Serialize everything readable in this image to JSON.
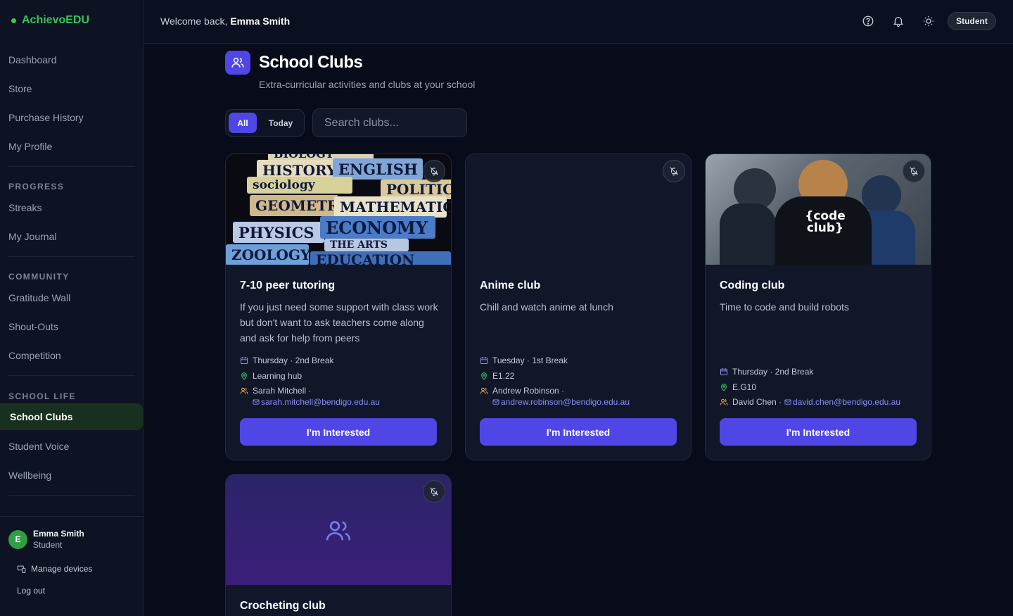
{
  "brand": {
    "name": "AchievoEDU"
  },
  "sidebar": {
    "main_items": [
      "Dashboard",
      "Store",
      "Purchase History",
      "My Profile"
    ],
    "progress": {
      "label": "PROGRESS",
      "items": [
        "Streaks",
        "My Journal"
      ]
    },
    "community": {
      "label": "COMMUNITY",
      "items": [
        "Gratitude Wall",
        "Shout-Outs",
        "Competition"
      ]
    },
    "school_life": {
      "label": "SCHOOL LIFE",
      "items": [
        "School Clubs",
        "Student Voice",
        "Wellbeing"
      ],
      "active": "School Clubs"
    },
    "user": {
      "initial": "E",
      "name": "Emma Smith",
      "role": "Student"
    },
    "footer": {
      "manage_devices": "Manage devices",
      "log_out": "Log out"
    }
  },
  "topbar": {
    "welcome_prefix": "Welcome back, ",
    "user_name": "Emma Smith",
    "role_label": "Student",
    "icons": [
      "help-icon",
      "bell-icon",
      "sun-icon"
    ]
  },
  "page": {
    "title": "School Clubs",
    "subtitle": "Extra-curricular activities and clubs at your school"
  },
  "filters": {
    "all": "All",
    "today": "Today",
    "active": "All"
  },
  "search": {
    "placeholder": "Search clubs..."
  },
  "clubs": [
    {
      "title": "7-10 peer tutoring",
      "description": "If you just need some support with class work but don't want to ask teachers come along and ask for help from peers",
      "schedule": "Thursday · 2nd Break",
      "location": "Learning hub",
      "contact": "Sarah Mitchell ·",
      "email": "sarah.mitchell@bendigo.edu.au",
      "button": "I'm Interested",
      "image_words": [
        "BIOLOGY",
        "HISTORY",
        "ENGLISH",
        "sociology",
        "POLITICS",
        "GEOMETRY",
        "MATHEMATICS",
        "PHYSICS",
        "ECONOMY",
        "THE ARTS",
        "ZOOLOGY",
        "EDUCATION"
      ]
    },
    {
      "title": "Anime club",
      "description": "Chill and watch anime at lunch",
      "schedule": "Tuesday · 1st Break",
      "location": "E1.22",
      "contact": "Andrew Robinson ·",
      "email": "andrew.robinson@bendigo.edu.au",
      "button": "I'm Interested"
    },
    {
      "title": "Coding club",
      "description": "Time to code and build robots",
      "schedule": "Thursday · 2nd Break",
      "location": "E.G10",
      "contact": "David Chen ·",
      "email": "david.chen@bendigo.edu.au",
      "button": "I'm Interested",
      "image_words": [
        "{code",
        "club}"
      ]
    },
    {
      "title": "Crocheting club"
    }
  ],
  "colors": {
    "accent": "#4f46e5",
    "brand_green": "#34c759",
    "background": "#070b1a",
    "card": "#111729",
    "email_link": "#8b8cf5"
  }
}
